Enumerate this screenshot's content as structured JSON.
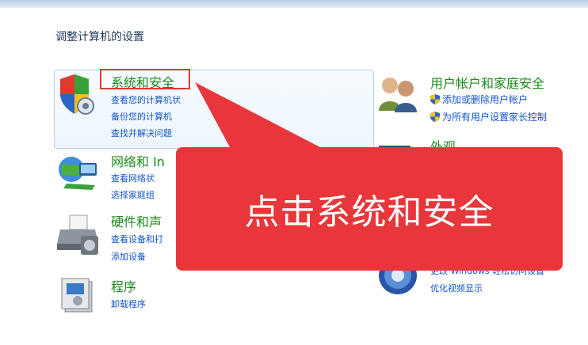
{
  "page": {
    "heading": "调整计算机的设置"
  },
  "categories": {
    "system_security": {
      "title": "系统和安全",
      "links": [
        "查看您的计算机状",
        "备份您的计算机",
        "查找并解决问题"
      ]
    },
    "network": {
      "title": "网络和 In",
      "links": [
        "查看网络状",
        "选择家庭组"
      ]
    },
    "hardware": {
      "title": "硬件和声",
      "links": [
        "查看设备和打",
        "添加设备"
      ]
    },
    "programs": {
      "title": "程序",
      "links": [
        "卸载程序"
      ]
    },
    "user_accounts": {
      "title": "用户帐户和家庭安全",
      "links": [
        "添加或删除用户帐户",
        "为所有用户设置家长控制"
      ]
    },
    "appearance": {
      "title": "外观",
      "links": [
        "更改 Windows 轻松访问设置",
        "优化视频显示"
      ]
    }
  },
  "callout": {
    "text": "点击系统和安全"
  },
  "colors": {
    "category_title": "#1a8c1a",
    "link": "#1155cc",
    "callout": "#e8363a",
    "highlight_border": "#e23a33"
  },
  "icons": {
    "system_security": "shield-icon",
    "network": "network-globe-icon",
    "hardware": "printer-icon",
    "programs": "programs-box-icon",
    "user_accounts": "users-icon",
    "appearance": "appearance-icon"
  }
}
